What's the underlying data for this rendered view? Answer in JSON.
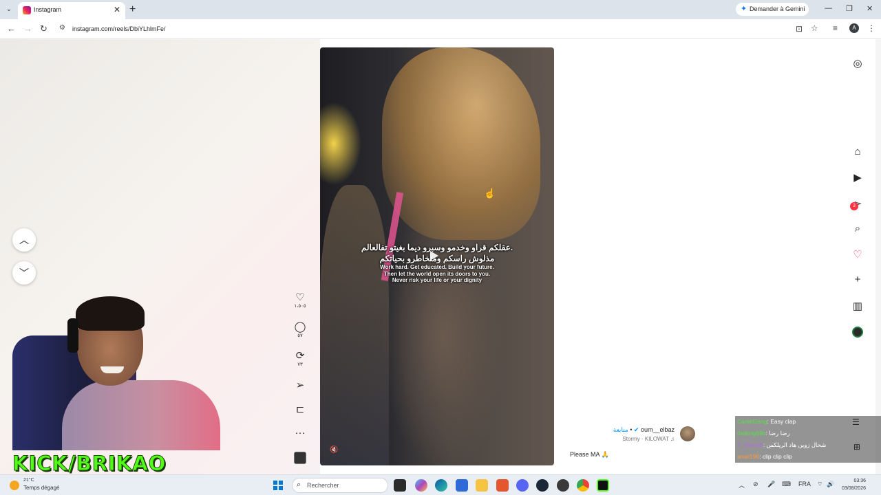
{
  "browser": {
    "tab_title": "Instagram",
    "tab_close": "✕",
    "new_tab": "+",
    "gemini_label": "Demander à Gemini",
    "url": "instagram.com/reels/DbiYLhlmFe/",
    "profile_initial": "A"
  },
  "reel": {
    "caption_ar_line1": "عقلكم قراو وخدمو وسبرو ديما بغيتو تفالعالم.",
    "caption_ar_line2": "مذلوش راسكم ومتخاطرو بحياتكم",
    "caption_en": [
      "Work hard. Get educated. Build your future.",
      "Then let the world open its doors to you.",
      "Never risk your life or your dignity"
    ],
    "likes": "١،٥٠٥",
    "comments": "٥٧",
    "reposts": "٧٣",
    "author_follow": "متابعة",
    "author_name": "oum__elbaz",
    "author_music": "Stormy · KILOWAT ♫",
    "comment_preview": "Please MA 🙏"
  },
  "icons": {
    "nav_up": "︿",
    "nav_down": "﹀",
    "like": "♡",
    "comment": "◯",
    "repost": "⟳",
    "share": "➢",
    "save": "⊏",
    "more": "···",
    "mute": "🔇",
    "home": "⌂",
    "reels": "▶",
    "messages": "➢",
    "search": "⌕",
    "notifications": "♡",
    "create": "+",
    "dashboard": "▥",
    "instagram": "◎",
    "messages_badge": "3"
  },
  "stream": {
    "kick_label": "KICK/BRIKAO",
    "chat": [
      {
        "user": "CartelGang",
        "msg": ": Easy clap"
      },
      {
        "user": "theking99b",
        "msg": ": رضا رضا"
      },
      {
        "user": "T_sbounh",
        "msg": ": شحال زوين هاد الريلكس"
      },
      {
        "user": "anali196",
        "msg": ": clip clip clip"
      }
    ]
  },
  "taskbar": {
    "weather_temp": "21°C",
    "weather_text": "Temps dégagé",
    "search_placeholder": "Rechercher",
    "language": "FRA",
    "time": "03:36",
    "date": "03/08/2026"
  }
}
